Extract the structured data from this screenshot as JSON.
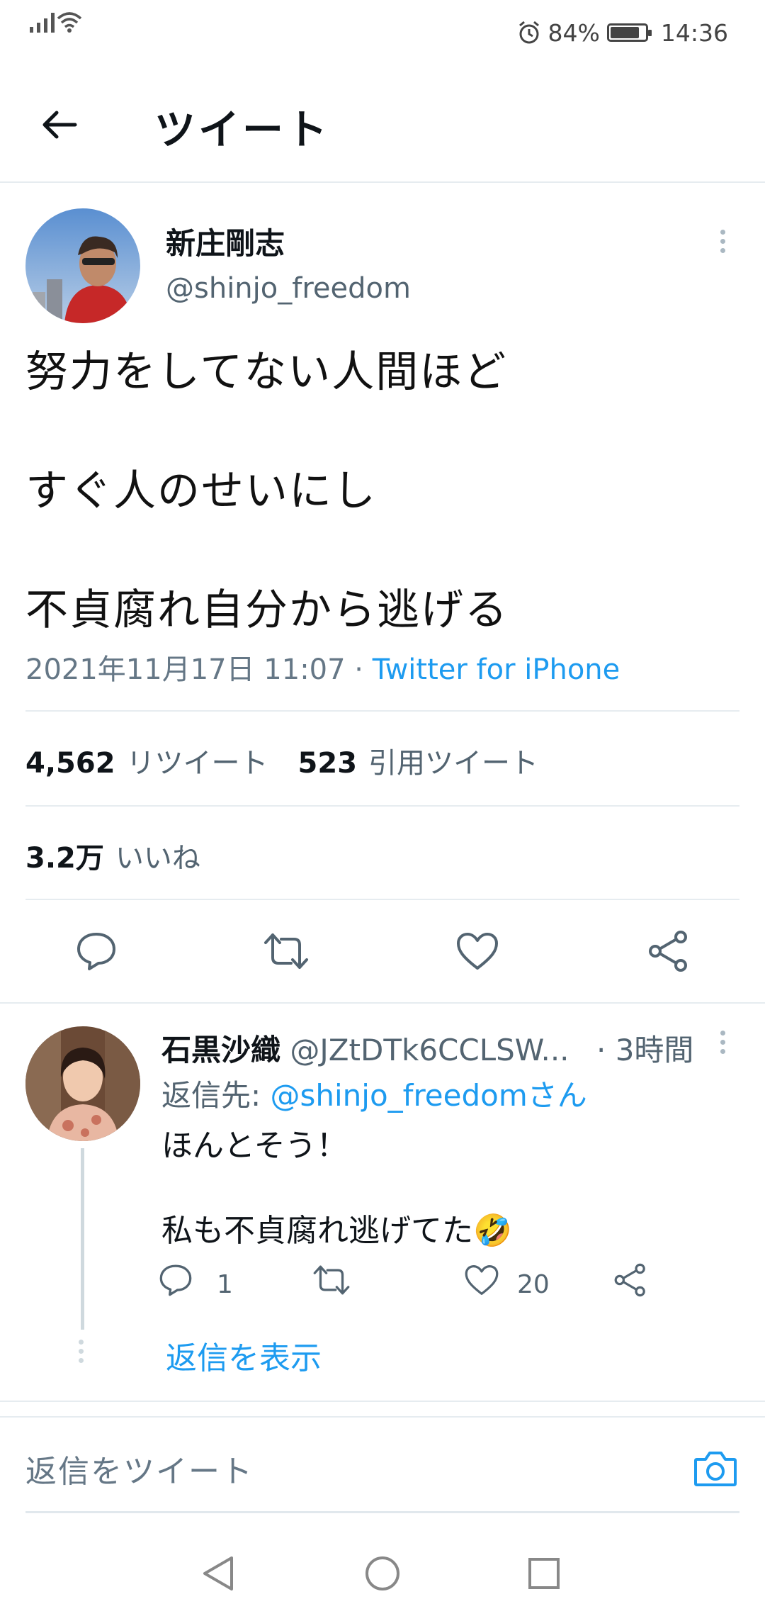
{
  "status_bar": {
    "battery_text": "84%",
    "battery_level": 0.84,
    "time": "14:36",
    "icons": [
      "signal-icon",
      "wifi-icon",
      "alarm-icon",
      "battery-icon"
    ]
  },
  "header": {
    "title": "ツイート",
    "back_icon": "arrow-left-icon"
  },
  "tweet": {
    "author_name": "新庄剛志",
    "author_handle": "@shinjo_freedom",
    "lines": [
      "努力をしてない人間ほど",
      "すぐ人のせいにし",
      "不貞腐れ自分から逃げる"
    ],
    "timestamp": "2021年11月17日 11:07",
    "separator": " · ",
    "source": "Twitter for iPhone",
    "retweets_count": "4,562",
    "retweets_label": "リツイート",
    "quotes_count": "523",
    "quotes_label": "引用ツイート",
    "likes_count": "3.2万",
    "likes_label": "いいね"
  },
  "reply": {
    "author_name": "石黒沙織",
    "author_handle": "@JZtDTk6CCLSW...",
    "time": "· 3時間",
    "reply_to_prefix": "返信先: ",
    "reply_to_mention": "@shinjo_freedomさん",
    "line1": "ほんとそう！",
    "line2": "私も不貞腐れ逃げてた🤣",
    "reply_count": "1",
    "like_count": "20",
    "show_replies": "返信を表示"
  },
  "compose": {
    "placeholder": "返信をツイート",
    "camera_icon": "camera-icon"
  },
  "colors": {
    "accent": "#1d9bf0",
    "text": "#0f1419",
    "secondary": "#536471",
    "divider": "#e6ecf0"
  }
}
